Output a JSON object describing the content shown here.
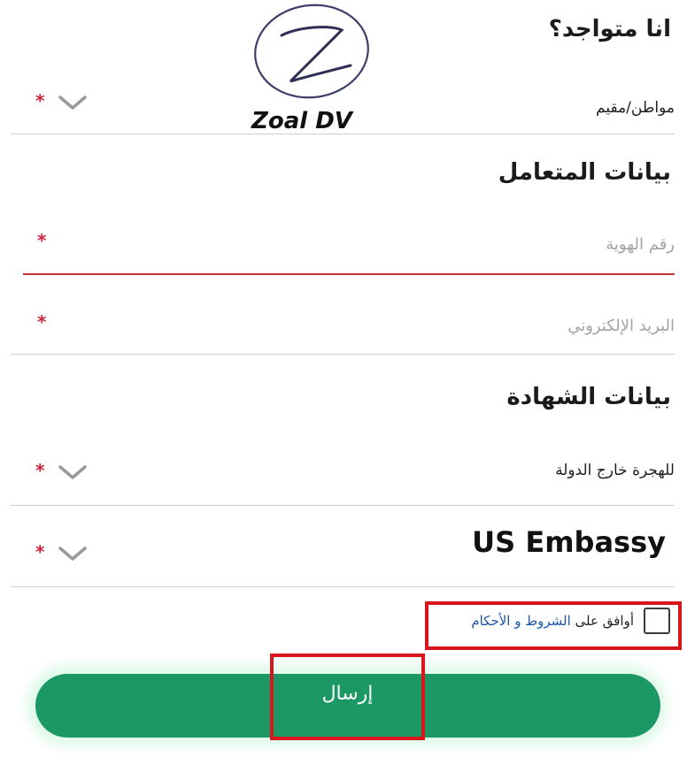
{
  "logo": {
    "text": "Zoal DV"
  },
  "section_location": {
    "heading": "انا متواجد؟",
    "residency_select": {
      "value": "مواطن/مقيم",
      "required_mark": "*",
      "icon": "chevron-down-icon"
    }
  },
  "section_customer": {
    "heading": "بيانات المتعامل",
    "id_number": {
      "placeholder": "رقم الهوية",
      "required_mark": "*"
    },
    "email": {
      "placeholder": "البريد الإلكتروني",
      "required_mark": "*"
    }
  },
  "section_certificate": {
    "heading": "بيانات الشهادة",
    "purpose_select": {
      "value": "للهجرة خارج الدولة",
      "required_mark": "*",
      "icon": "chevron-down-icon"
    },
    "addressee_select": {
      "value": "US Embassy",
      "required_mark": "*",
      "icon": "chevron-down-icon"
    }
  },
  "terms": {
    "agree_prefix": "أوافق على",
    "link_text": "الشروط و الأحكام",
    "checked": false
  },
  "submit": {
    "label": "إرسال"
  },
  "colors": {
    "accent_green": "#1c9865",
    "required_red": "#d0233a",
    "highlight_red": "#d9151e",
    "link_blue": "#1c56a6"
  }
}
